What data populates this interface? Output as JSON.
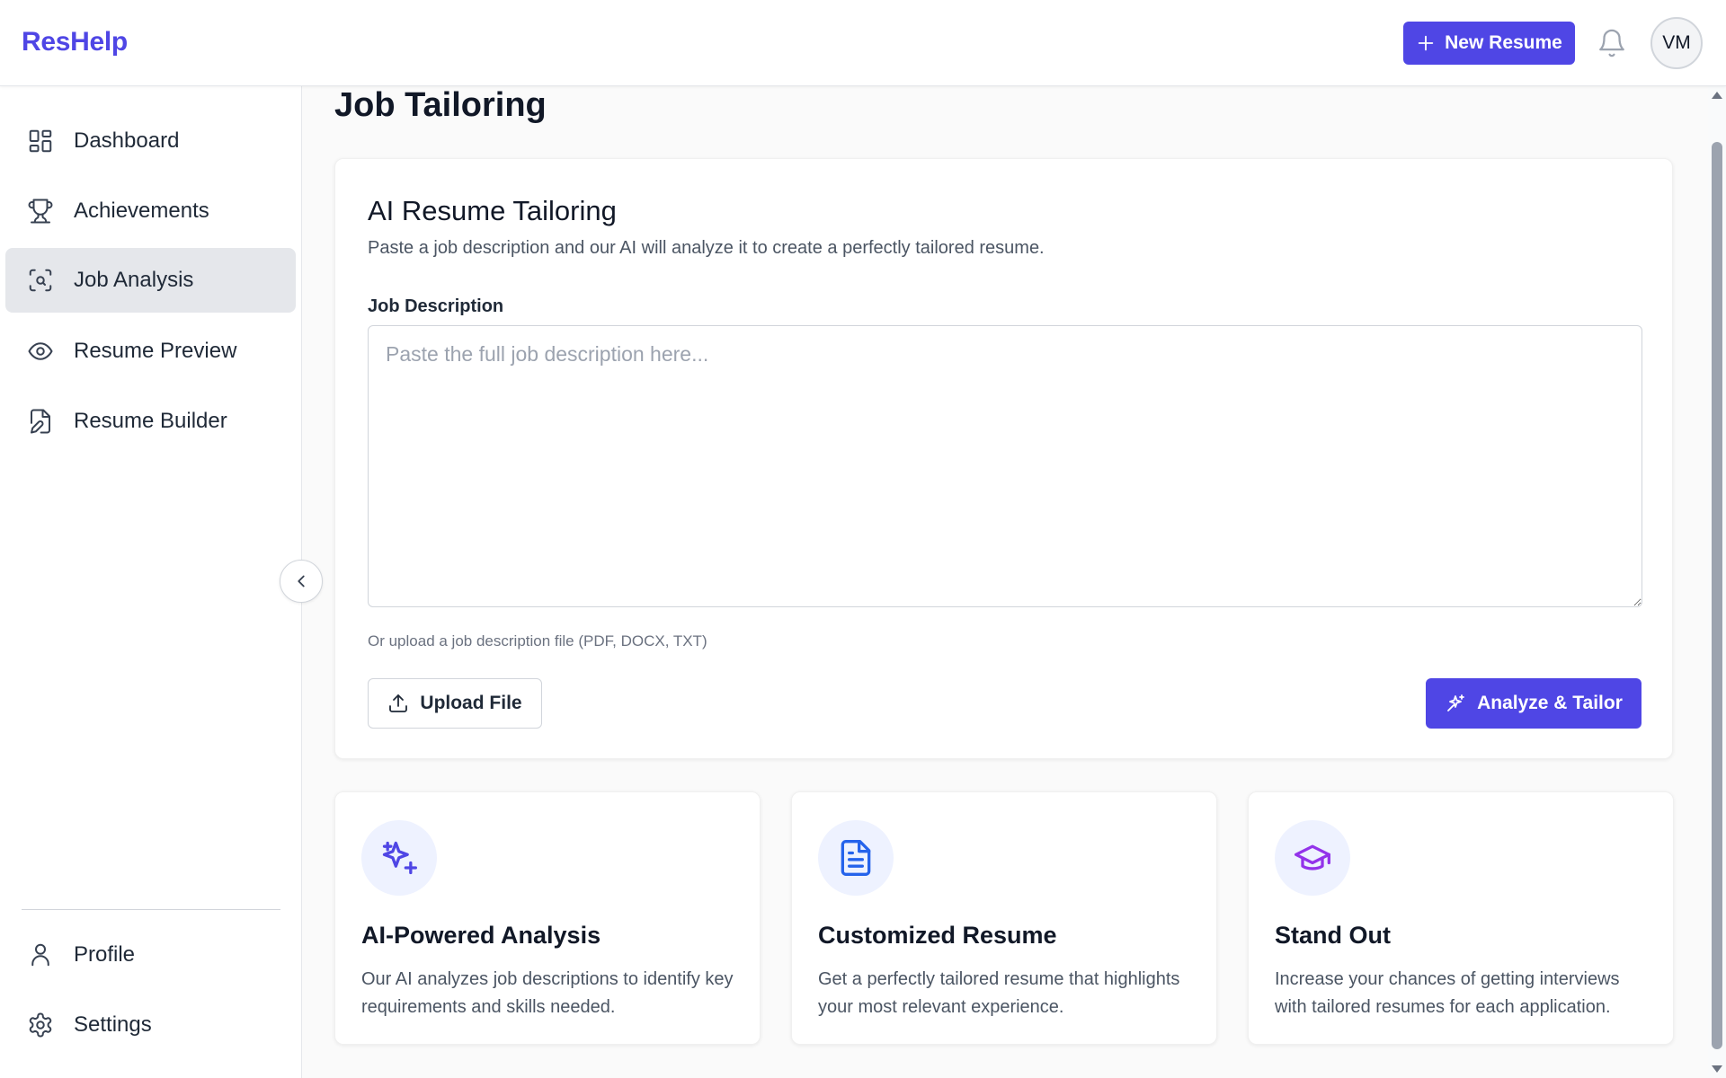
{
  "app": {
    "logo": "ResHelp"
  },
  "header": {
    "new_resume_label": "New Resume",
    "avatar_initials": "VM"
  },
  "sidebar": {
    "items": [
      {
        "label": "Dashboard",
        "icon": "dashboard-grid-icon",
        "active": false
      },
      {
        "label": "Achievements",
        "icon": "trophy-icon",
        "active": false
      },
      {
        "label": "Job Analysis",
        "icon": "scan-search-icon",
        "active": true
      },
      {
        "label": "Resume Preview",
        "icon": "eye-icon",
        "active": false
      },
      {
        "label": "Resume Builder",
        "icon": "file-edit-icon",
        "active": false
      }
    ],
    "footer_items": [
      {
        "label": "Profile",
        "icon": "user-icon"
      },
      {
        "label": "Settings",
        "icon": "gear-icon"
      }
    ]
  },
  "main": {
    "page_title": "Job Tailoring",
    "tailoring_card": {
      "title": "AI Resume Tailoring",
      "subtitle": "Paste a job description and our AI will analyze it to create a perfectly tailored resume.",
      "field_label": "Job Description",
      "textarea_value": "",
      "textarea_placeholder": "Paste the full job description here...",
      "upload_hint": "Or upload a job description file (PDF, DOCX, TXT)",
      "upload_button": "Upload File",
      "analyze_button": "Analyze & Tailor"
    },
    "features": [
      {
        "title": "AI-Powered Analysis",
        "description": "Our AI analyzes job descriptions to identify key requirements and skills needed.",
        "icon": "sparkles-icon",
        "icon_color": "#4f46e5"
      },
      {
        "title": "Customized Resume",
        "description": "Get a perfectly tailored resume that highlights your most relevant experience.",
        "icon": "document-icon",
        "icon_color": "#2563eb"
      },
      {
        "title": "Stand Out",
        "description": "Increase your chances of getting interviews with tailored resumes for each application.",
        "icon": "graduation-cap-icon",
        "icon_color": "#9333ea"
      }
    ]
  },
  "colors": {
    "accent": "#4f46e5",
    "active_nav_bg": "#e5e7eb"
  }
}
